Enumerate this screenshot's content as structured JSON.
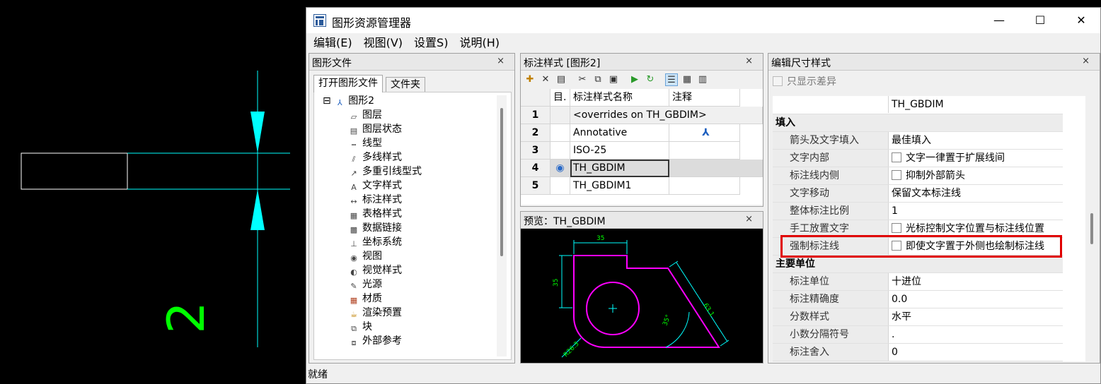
{
  "window": {
    "title": "图形资源管理器",
    "minimize": "—",
    "maximize": "☐",
    "close": "✕"
  },
  "menu": [
    "编辑(E)",
    "视图(V)",
    "设置S)",
    "说明(H)"
  ],
  "file_panel": {
    "title": "图形文件",
    "close": "×",
    "tabs": [
      "打开图形文件",
      "文件夹"
    ],
    "root": {
      "expander": "⊟",
      "label": "图形2"
    },
    "items": [
      "图层",
      "图层状态",
      "线型",
      "多线样式",
      "多重引线型式",
      "文字样式",
      "标注样式",
      "表格样式",
      "数据链接",
      "坐标系统",
      "视图",
      "视觉样式",
      "光源",
      "材质",
      "渲染预置",
      "块",
      "外部参考"
    ]
  },
  "dimstyle_panel": {
    "title": "标注样式 [图形2]",
    "close": "×",
    "columns": [
      "目.",
      "标注样式名称",
      "注释"
    ],
    "rows": [
      {
        "num": "1",
        "name": "<overrides on TH_GBDIM>",
        "annot": ""
      },
      {
        "num": "2",
        "name": "Annotative",
        "annot": "⅄"
      },
      {
        "num": "3",
        "name": "ISO-25",
        "annot": ""
      },
      {
        "num": "4",
        "name": "TH_GBDIM",
        "annot": ""
      },
      {
        "num": "5",
        "name": "TH_GBDIM1",
        "annot": ""
      }
    ],
    "selected_row": 4
  },
  "preview_panel": {
    "title": "预览：TH_GBDIM",
    "close": "×",
    "dims": {
      "top": "35",
      "left": "35",
      "diag": "63.1",
      "angle": "35°",
      "radius": "R26.3"
    }
  },
  "edit_panel": {
    "title": "编辑尺寸样式",
    "close": "×",
    "only_diff": "只显示差异",
    "style_name": "TH_GBDIM",
    "category_fill": "填入",
    "category_units": "主要单位",
    "fill_rows": [
      {
        "name": "箭头及文字填入",
        "value": "最佳填入",
        "check": false
      },
      {
        "name": "文字内部",
        "value": "文字一律置于扩展线间",
        "check": true
      },
      {
        "name": "标注线内侧",
        "value": "抑制外部箭头",
        "check": true
      },
      {
        "name": "文字移动",
        "value": "保留文本标注线",
        "check": false
      },
      {
        "name": "整体标注比例",
        "value": "1",
        "check": false
      },
      {
        "name": "手工放置文字",
        "value": "光标控制文字位置与标注线位置",
        "check": true
      },
      {
        "name": "强制标注线",
        "value": "即使文字置于外侧也绘制标注线",
        "check": true
      }
    ],
    "unit_rows": [
      {
        "name": "标注单位",
        "value": "十进位"
      },
      {
        "name": "标注精确度",
        "value": "0.0"
      },
      {
        "name": "分数样式",
        "value": "水平"
      },
      {
        "name": "小数分隔符号",
        "value": "."
      },
      {
        "name": "标注舍入",
        "value": "0"
      }
    ]
  },
  "status": "就绪",
  "cad": {
    "dim_text": "2"
  },
  "colors": {
    "accent_cyan": "#00ffff",
    "preview_magenta": "#ff00ff",
    "dim_green": "#00ff00",
    "highlight_red": "#e00000"
  }
}
